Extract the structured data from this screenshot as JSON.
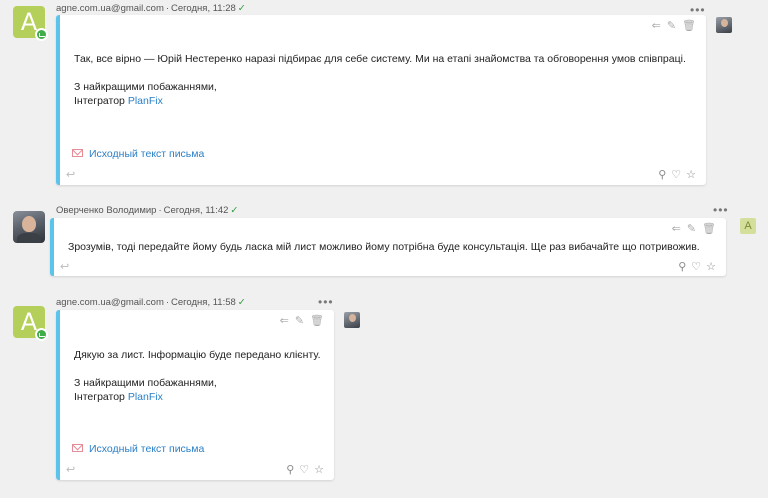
{
  "messages": [
    {
      "sender": "agne.com.ua@gmail.com",
      "time": "Сегодня, 11:28",
      "check": "✓",
      "avatar_letter": "A",
      "more": "•••",
      "toolbar": {
        "reply": "⇐",
        "edit": "✎",
        "delete": "🗑"
      },
      "lines": [
        "Так, все вірно — Юрій Нестеренко наразі підбирає для себе систему. Ми на етапі знайомства та обговорення умов співпраці.",
        "З найкращими побажаннями,",
        "Інтегратор"
      ],
      "link": "PlanFix",
      "original_label": "Исходный текст письма",
      "actions": {
        "pin": "⚲",
        "like": "♡",
        "star": "☆"
      },
      "reply_icon": "↩"
    },
    {
      "sender": "Оверченко Володимир",
      "time": "Сегодня, 11:42",
      "check": "✓",
      "more": "•••",
      "mini_letter": "A",
      "toolbar": {
        "reply": "⇐",
        "edit": "✎",
        "delete": "🗑"
      },
      "text": "Зрозумів, тоді передайте йому будь ласка мій лист можливо йому потрібна буде консультація. Ще раз вибачайте що потривожив.",
      "actions": {
        "pin": "⚲",
        "like": "♡",
        "star": "☆"
      },
      "reply_icon": "↩"
    },
    {
      "sender": "agne.com.ua@gmail.com",
      "time": "Сегодня, 11:58",
      "check": "✓",
      "avatar_letter": "A",
      "more": "•••",
      "toolbar": {
        "reply": "⇐",
        "edit": "✎",
        "delete": "🗑"
      },
      "lines": [
        "Дякую за лист. Інформацію буде передано клієнту.",
        "З найкращими побажаннями,",
        "Інтегратор"
      ],
      "link": "PlanFix",
      "original_label": "Исходный текст письма",
      "actions": {
        "pin": "⚲",
        "like": "♡",
        "star": "☆"
      },
      "reply_icon": "↩"
    }
  ]
}
